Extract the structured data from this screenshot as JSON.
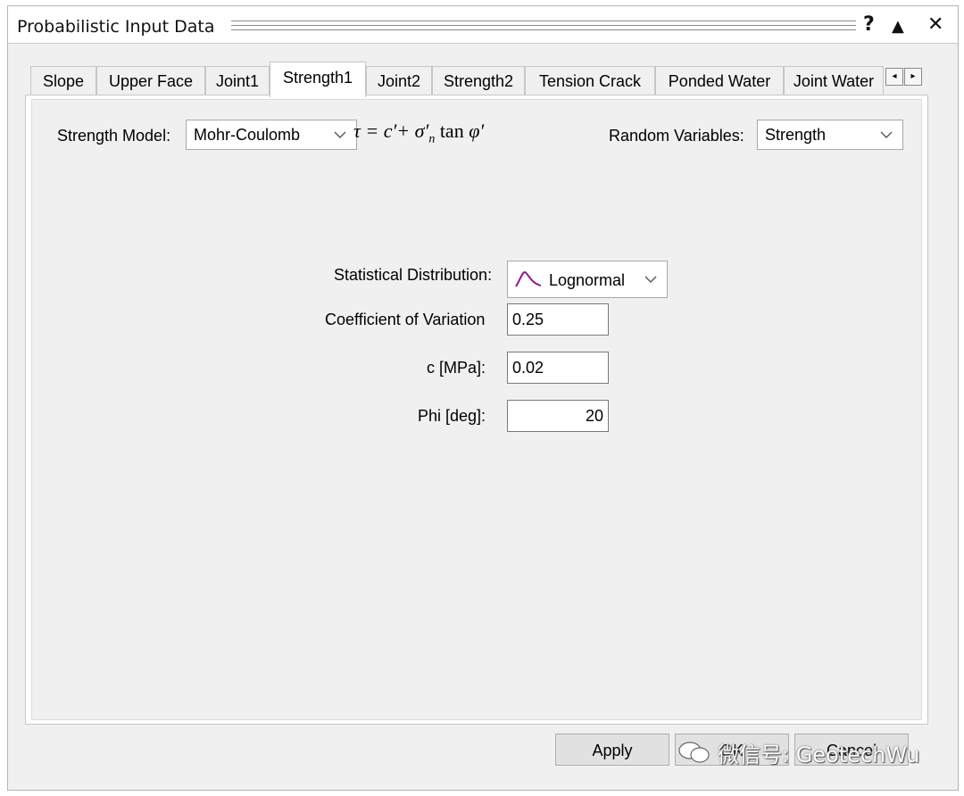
{
  "window": {
    "title": "Probabilistic Input Data",
    "help_label": "?",
    "collapse_label": "▲",
    "close_label": "✕"
  },
  "tabs": [
    {
      "label": "Slope"
    },
    {
      "label": "Upper Face"
    },
    {
      "label": "Joint1"
    },
    {
      "label": "Strength1",
      "active": true
    },
    {
      "label": "Joint2"
    },
    {
      "label": "Strength2"
    },
    {
      "label": "Tension Crack"
    },
    {
      "label": "Ponded Water"
    },
    {
      "label": "Joint Water"
    }
  ],
  "tab_scroll": {
    "left": "◂",
    "right": "▸"
  },
  "strength_model": {
    "label": "Strength Model:",
    "value": "Mohr-Coulomb"
  },
  "formula": {
    "text": "τ = c′ + σ′n tan φ′"
  },
  "random_variables": {
    "label": "Random Variables:",
    "value": "Strength"
  },
  "distribution": {
    "label": "Statistical Distribution:",
    "value": "Lognormal",
    "icon": "lognormal-curve-icon",
    "icon_color": "#8b1a8b"
  },
  "cov": {
    "label": "Coefficient of Variation",
    "value": "0.25"
  },
  "cohesion": {
    "label": "c [MPa]:",
    "value": "0.02"
  },
  "phi": {
    "label": "Phi [deg]:",
    "value": "20"
  },
  "buttons": {
    "apply": "Apply",
    "ok": "OK",
    "cancel": "Cancel"
  },
  "watermark": {
    "text": "微信号: GeotechWu"
  }
}
